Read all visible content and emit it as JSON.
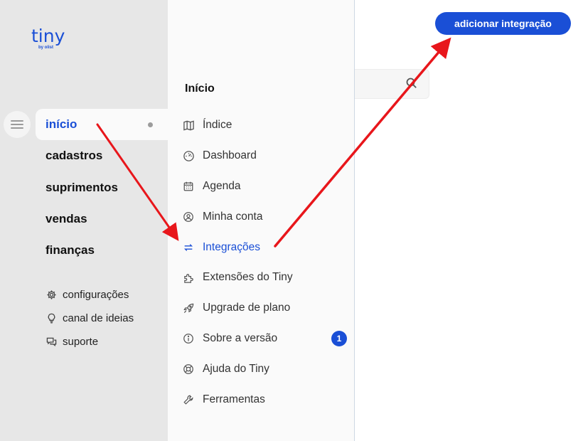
{
  "logo": {
    "word": "tiny",
    "sub": "by olist"
  },
  "sidebar": {
    "main_items": [
      {
        "label": "início",
        "active": true
      },
      {
        "label": "cadastros"
      },
      {
        "label": "suprimentos"
      },
      {
        "label": "vendas"
      },
      {
        "label": "finanças"
      }
    ],
    "secondary_items": [
      {
        "label": "configurações",
        "icon": "gear-icon"
      },
      {
        "label": "canal de ideias",
        "icon": "lightbulb-icon"
      },
      {
        "label": "suporte",
        "icon": "chat-icon"
      }
    ]
  },
  "submenu": {
    "title": "Início",
    "items": [
      {
        "label": "Índice",
        "icon": "map-icon"
      },
      {
        "label": "Dashboard",
        "icon": "gauge-icon"
      },
      {
        "label": "Agenda",
        "icon": "calendar-icon"
      },
      {
        "label": "Minha conta",
        "icon": "user-circle-icon"
      },
      {
        "label": "Integrações",
        "icon": "arrows-exchange-icon",
        "active": true
      },
      {
        "label": "Extensões do Tiny",
        "icon": "puzzle-icon"
      },
      {
        "label": "Upgrade de plano",
        "icon": "rocket-icon"
      },
      {
        "label": "Sobre a versão",
        "icon": "info-icon",
        "badge": "1"
      },
      {
        "label": "Ajuda do Tiny",
        "icon": "lifebuoy-icon"
      },
      {
        "label": "Ferramentas",
        "icon": "wrench-icon"
      }
    ]
  },
  "content": {
    "add_button_label": "adicionar integração"
  },
  "colors": {
    "accent": "#1a4fd6",
    "sidebar_bg": "#e7e7e7",
    "submenu_bg": "#fafafa",
    "annotation_arrow": "#e8161b"
  }
}
